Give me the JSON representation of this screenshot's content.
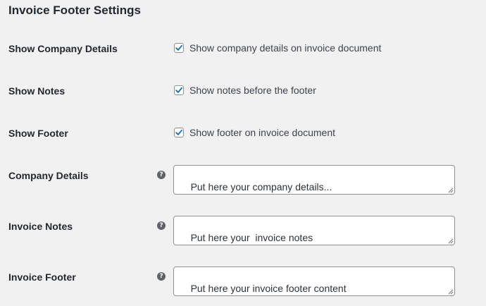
{
  "title": "Invoice Footer Settings",
  "rows": {
    "show_company_details": {
      "label": "Show Company Details",
      "checkbox_label": "Show company details on invoice document",
      "checked": true
    },
    "show_notes": {
      "label": "Show Notes",
      "checkbox_label": "Show notes before the footer",
      "checked": true
    },
    "show_footer": {
      "label": "Show Footer",
      "checkbox_label": "Show footer on invoice document",
      "checked": true
    },
    "company_details": {
      "label": "Company Details",
      "help_icon": "question-circle-icon",
      "value": "Put here your company details..."
    },
    "invoice_notes": {
      "label": "Invoice Notes",
      "help_icon": "question-circle-icon",
      "value": "Put here your  invoice notes"
    },
    "invoice_footer": {
      "label": "Invoice Footer",
      "help_icon": "question-circle-icon",
      "value": "Put here your invoice footer content"
    }
  },
  "colors": {
    "background": "#f1f1f1",
    "checkmark": "#2271b1",
    "help_icon": "#5f6368",
    "border": "#8c8f94"
  }
}
